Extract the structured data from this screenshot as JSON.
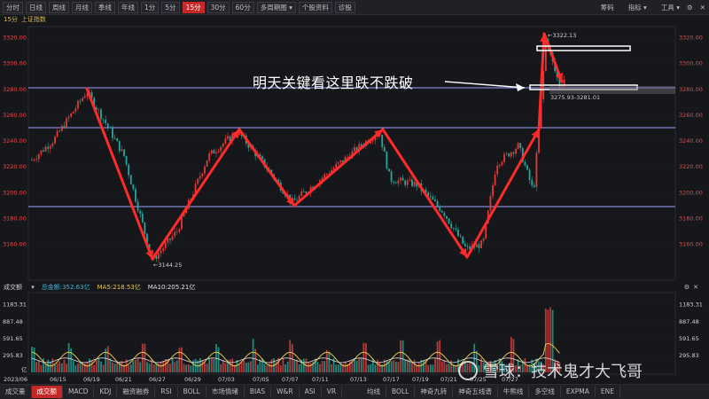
{
  "toolbar": {
    "buttons": [
      "分时",
      "日线",
      "周线",
      "月线",
      "季线",
      "年线",
      "1分",
      "5分",
      "15分",
      "30分",
      "60分"
    ],
    "active": "15分",
    "menu_more_period": "多周期图",
    "stock_info": "个股资料",
    "diagnose": "诊股",
    "right_items": [
      "筹码",
      "指标",
      "工具"
    ]
  },
  "chart_header": {
    "period": "15分",
    "index_name": "上证指数"
  },
  "price_axis": {
    "labels": [
      "3320.00",
      "3300.00",
      "3280.00",
      "3260.00",
      "3240.00",
      "3220.00",
      "3200.00",
      "3180.00",
      "3160.00"
    ]
  },
  "annotations": {
    "high_label": "←3322.13",
    "low_label": "←3144.25",
    "range_label": "3275.93-3281.01",
    "note": "明天关键看这里跌不跌破"
  },
  "volume_header": {
    "selector": "成交额",
    "total": "总金额:352.63亿",
    "ma5": "MA5:218.53亿",
    "ma10": "MA10:205.21亿",
    "colors": {
      "total": "#39b8d8",
      "ma5": "#e8c84a",
      "ma10": "#e0e0e0"
    }
  },
  "volume_axis": {
    "labels": [
      "1183.31",
      "887.48",
      "591.65",
      "295.83"
    ],
    "unit": "亿"
  },
  "date_axis": [
    "2023/06",
    "06/15",
    "06/19",
    "06/21",
    "06/27",
    "06/29",
    "07/03",
    "07/05",
    "07/07",
    "07/11",
    "07/13",
    "07/17",
    "07/19",
    "07/21",
    "07/25",
    "07/27"
  ],
  "bottom_tabs": {
    "left": [
      "成交量",
      "成交额",
      "MACD",
      "KDJ",
      "融资融券",
      "RSI",
      "BOLL",
      "市场情绪",
      "BIAS",
      "W&R",
      "ASI",
      "VR"
    ],
    "left_active": "成交额",
    "right": [
      "均线",
      "BOLL",
      "神奇九转",
      "神奇五线谱",
      "牛熊线",
      "多空线",
      "EXPMA",
      "ENE"
    ]
  },
  "watermark": "雪球：技术鬼才大飞哥",
  "colors": {
    "up": "#e53935",
    "down": "#26a69a",
    "bg": "#16171b",
    "hline": "#9aa3ff",
    "arrow": "#ff2a2a"
  }
}
